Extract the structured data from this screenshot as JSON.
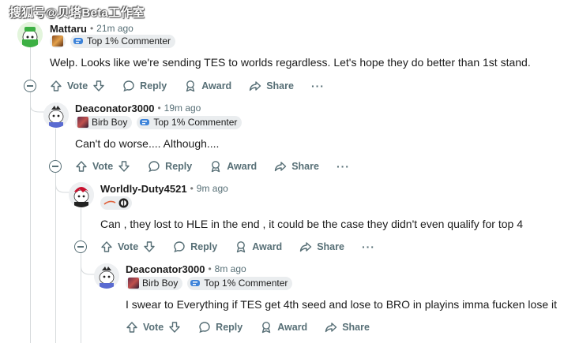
{
  "watermark": "搜狐号@贝塔Beta工作室",
  "actions": {
    "vote": "Vote",
    "reply": "Reply",
    "award": "Award",
    "share": "Share",
    "more": "···"
  },
  "comments": [
    {
      "username": "Mattaru",
      "time": "21m ago",
      "flairs": [
        "Top 1% Commenter"
      ],
      "body": "Welp. Looks like we're sending TES to worlds regardless. Let's hope they do better than 1st stand."
    },
    {
      "username": "Deaconator3000",
      "time": "19m ago",
      "flairs": [
        "Birb Boy",
        "Top 1% Commenter"
      ],
      "body": "Can't do worse.... Although...."
    },
    {
      "username": "Worldly-Duty4521",
      "time": "9m ago",
      "flairs": [],
      "body": "Can , they lost to HLE in the end , it could be the case they didn't even qualify for top 4"
    },
    {
      "username": "Deaconator3000",
      "time": "8m ago",
      "flairs": [
        "Birb Boy",
        "Top 1% Commenter"
      ],
      "body": "I swear to Everything if TES get 4th seed and lose to BRO in playins imma fucken lose it"
    }
  ],
  "colors": {
    "text": "#1c1c1c",
    "muted": "#576f76",
    "flair_bg": "#eaedef",
    "thread_line": "#d6dadc"
  }
}
